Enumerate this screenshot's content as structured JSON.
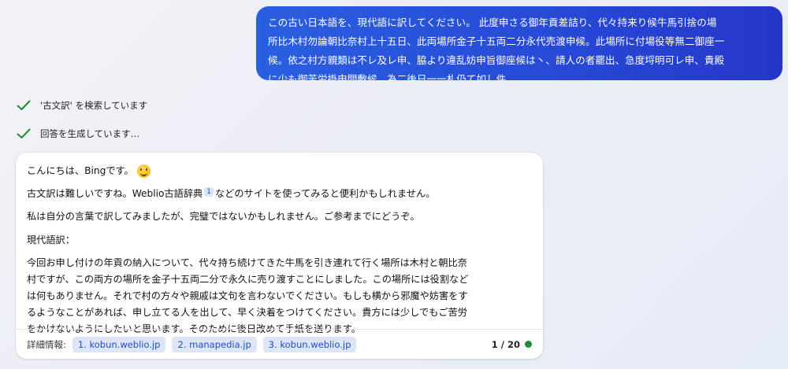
{
  "user_message": {
    "line1": "この古い日本語を、現代語に訳してください。 此度申さる御年貢差詰り、代々持来り候牛馬引捨の場",
    "line2": "所比木村勿論朝比奈村上十五日、此両場所金子十五両二分永代売渡申候。此場所に付場役等無二御座一",
    "line3": "候。依之村方親類は不レ及レ申、脇より違乱妨申旨御座候は丶、請人の者罷出、急度埒明可レ申、貴殿",
    "line4": "に少も御苦労掛申間敷候。為二後日一一札仍て如し件"
  },
  "status": {
    "searching": "'古文訳' を検索しています",
    "generating": "回答を生成しています…"
  },
  "answer": {
    "greeting": "こんにちは、Bingです。",
    "p2_before": "古文訳は難しいですね。Weblio古語辞典",
    "p2_cite": "1",
    "p2_after": "などのサイトを使ってみると便利かもしれません。",
    "p3": "私は自分の言葉で訳してみましたが、完璧ではないかもしれません。ご参考までにどうぞ。",
    "p4": "現代語訳：",
    "p5_line1": "今回お申し付けの年貢の納入について、代々持ち続けてきた牛馬を引き連れて行く場所は木村と朝比奈",
    "p5_line2": "村ですが、この両方の場所を金子十五両二分で永久に売り渡すことにしました。この場所には役割など",
    "p5_line3": "は何もありません。それで村の方々や親戚は文句を言わないでください。もしも横から邪魔や妨害をす",
    "p5_line4": "るようなことがあれば、申し立てる人を出して、早く決着をつけてください。貴方には少しでもご苦労",
    "p5_line5": "をかけないようにしたいと思います。そのために後日改めて手紙を送ります。"
  },
  "footer": {
    "label": "詳細情報:",
    "sources": [
      "1. kobun.weblio.jp",
      "2. manapedia.jp",
      "3. kobun.weblio.jp"
    ],
    "counter": "1 / 20"
  },
  "colors": {
    "user_bubble": "#2748d6",
    "check": "#1e8a3a",
    "chip_bg": "#dde5f7",
    "chip_text": "#1f4fc2",
    "status_dot": "#1e8a3a"
  },
  "icons": {
    "check": "check-icon",
    "emoji": "smiling-face-emoji-icon"
  }
}
